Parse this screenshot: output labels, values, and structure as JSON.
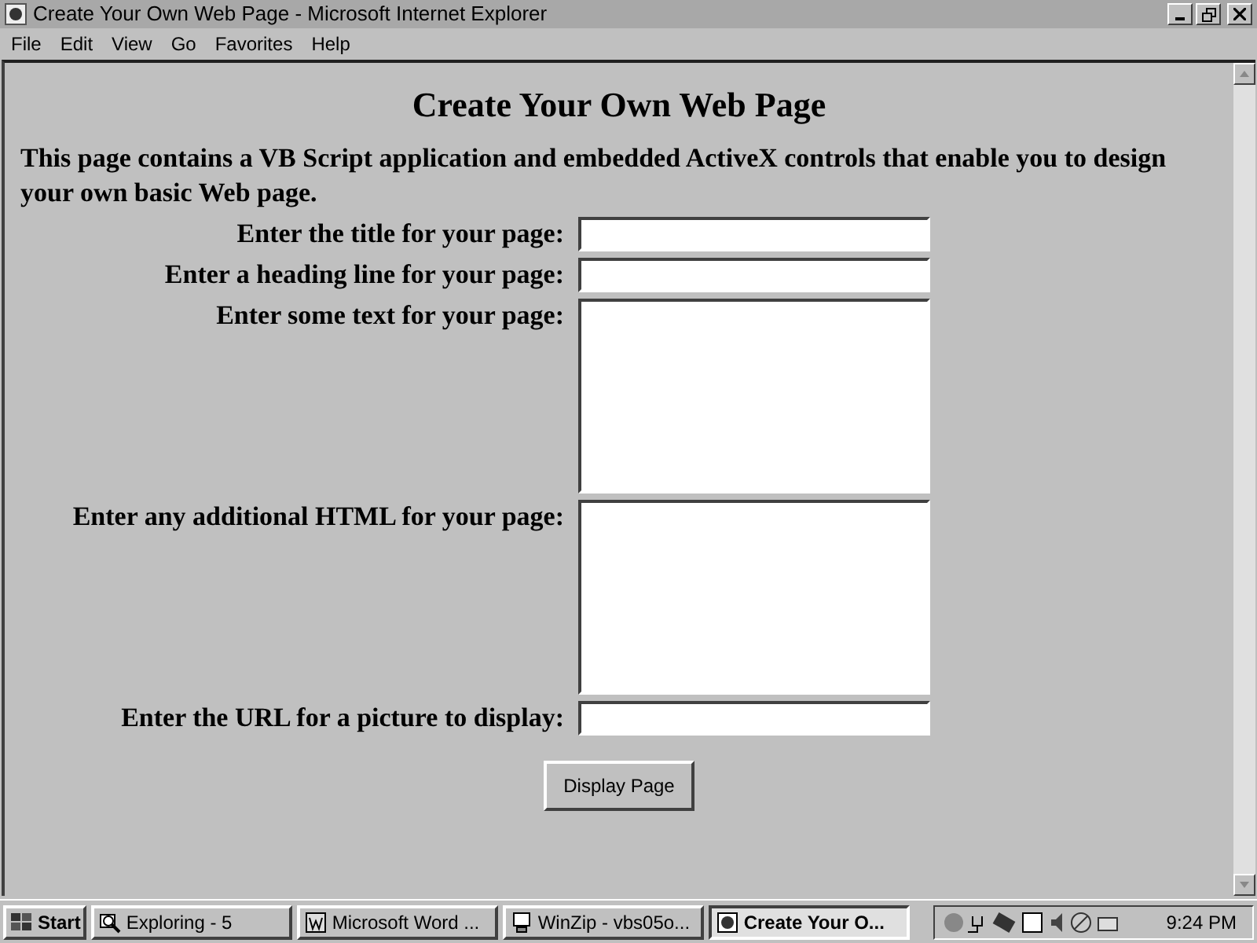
{
  "window": {
    "title": "Create Your Own Web Page - Microsoft Internet Explorer"
  },
  "menu": [
    "File",
    "Edit",
    "View",
    "Go",
    "Favorites",
    "Help"
  ],
  "page": {
    "heading": "Create Your Own Web Page",
    "intro": "This page contains a VB Script application and embedded ActiveX controls that enable you to design your own basic Web page.",
    "fields": [
      {
        "label": "Enter the title for your page:",
        "kind": "line"
      },
      {
        "label": "Enter a heading line for your page:",
        "kind": "line"
      },
      {
        "label": "Enter some text for your page:",
        "kind": "area"
      },
      {
        "label": "Enter any additional HTML for your page:",
        "kind": "area"
      },
      {
        "label": "Enter the URL for a picture to display:",
        "kind": "line"
      }
    ],
    "button": "Display Page"
  },
  "taskbar": {
    "start": "Start",
    "tasks": [
      {
        "label": "Exploring - 5",
        "selected": false
      },
      {
        "label": "Microsoft Word ...",
        "selected": false
      },
      {
        "label": "WinZip - vbs05o...",
        "selected": false
      },
      {
        "label": "Create Your O...",
        "selected": true
      }
    ],
    "clock": "9:24 PM"
  }
}
